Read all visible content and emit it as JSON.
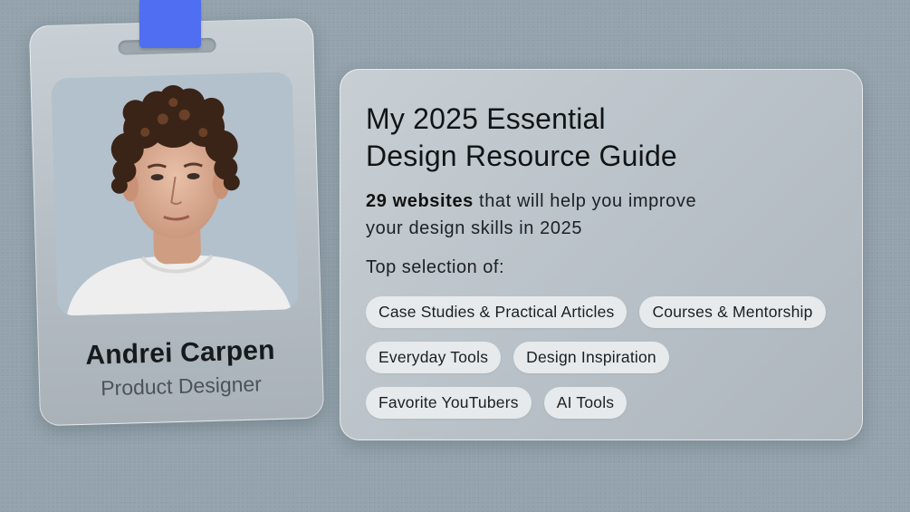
{
  "badge": {
    "name": "Andrei Carpen",
    "role": "Product Designer",
    "photo_alt": "portrait photo"
  },
  "guide": {
    "title_line1": "My 2025 Essential",
    "title_line2": "Design Resource Guide",
    "subtitle_bold": "29 websites",
    "subtitle_rest1": " that will help you improve",
    "subtitle_rest2": "your design skills in 2025",
    "selection_label": "Top selection of:",
    "chips": [
      [
        "Case Studies & Practical Articles",
        "Courses & Mentorship"
      ],
      [
        "Everyday Tools",
        "Design Inspiration"
      ],
      [
        "Favorite YouTubers",
        "AI Tools"
      ]
    ]
  },
  "colors": {
    "background": "#93a2ac",
    "lanyard": "#4f6ef2",
    "chip": "#e6eaec"
  }
}
